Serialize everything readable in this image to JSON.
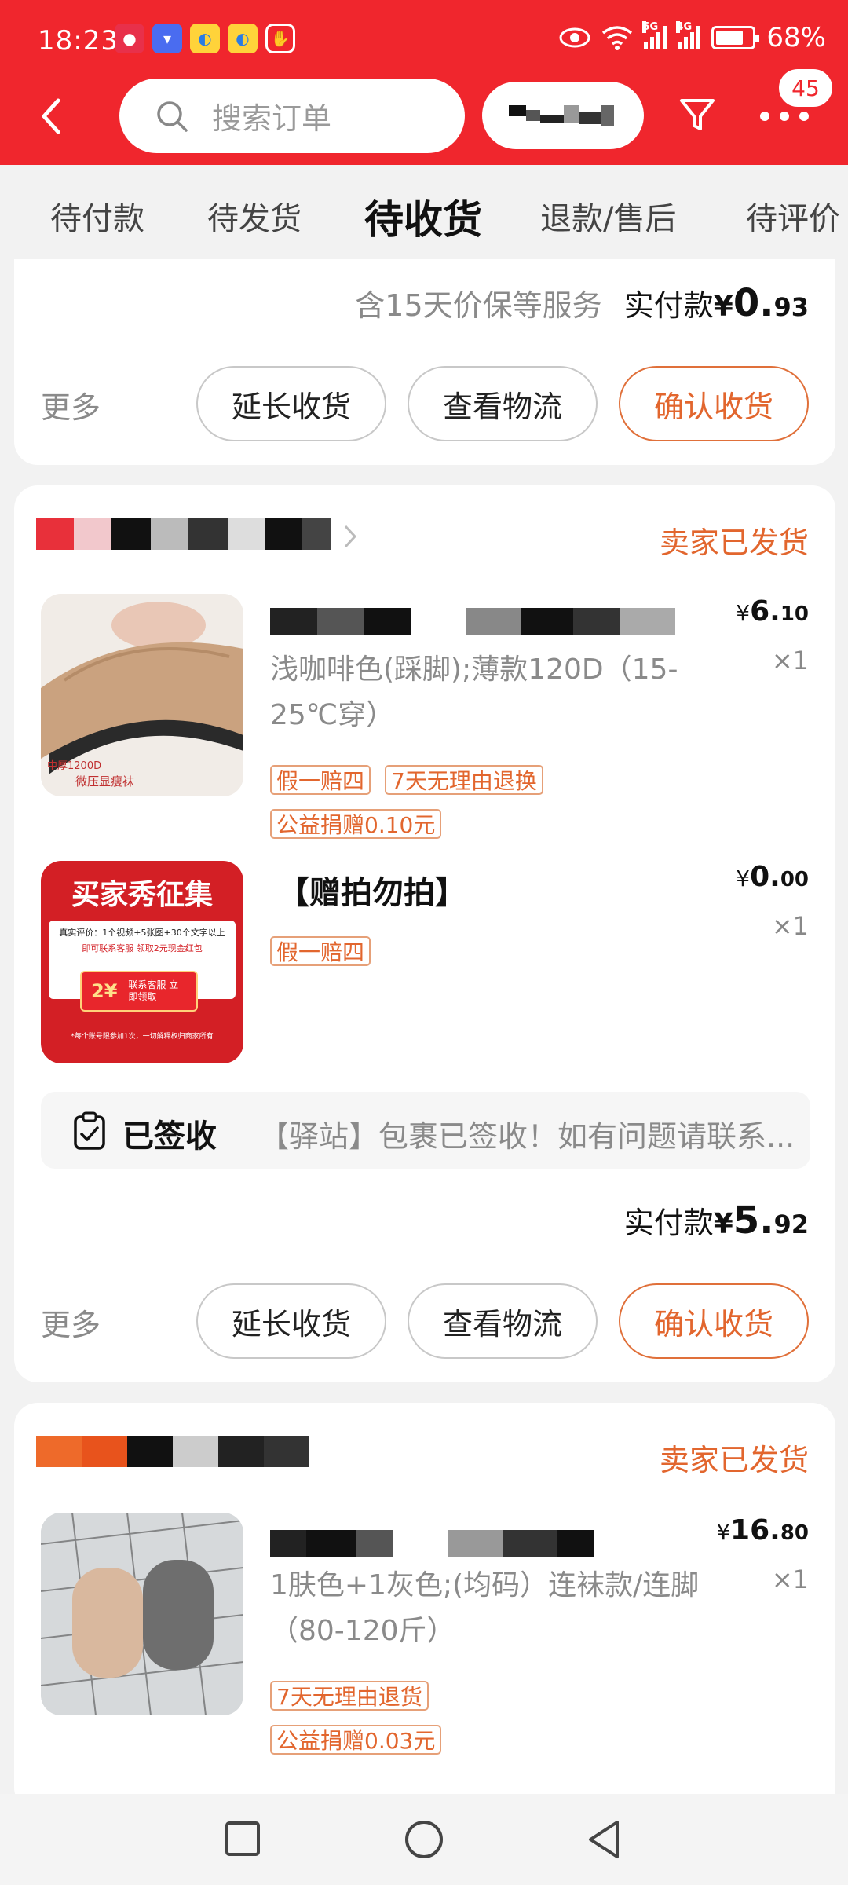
{
  "status_bar": {
    "time": "18:23",
    "battery": "68%",
    "net1": "5G",
    "net2": "4G"
  },
  "header": {
    "search_placeholder": "搜索订单",
    "badge_count": "45"
  },
  "tabs": [
    {
      "label": "待付款"
    },
    {
      "label": "待发货"
    },
    {
      "label": "待收货",
      "active": true
    },
    {
      "label": "退款/售后"
    },
    {
      "label": "待评价"
    }
  ],
  "orders": [
    {
      "service_note": "含15天价保等服务",
      "paid_label": "实付款",
      "paid_symbol": "¥",
      "paid_int": "0.",
      "paid_dec": "93",
      "more": "更多",
      "btn_extend": "延长收货",
      "btn_logistics": "查看物流",
      "btn_confirm": "确认收货"
    },
    {
      "status": "卖家已发货",
      "items": [
        {
          "spec": "浅咖啡色(踩脚);薄款120D（15-25℃穿）",
          "price_symbol": "¥",
          "price_int": "6.",
          "price_dec": "10",
          "qty": "×1",
          "tags": [
            "假一赔四",
            "7天无理由退换",
            "公益捐赠0.10元"
          ],
          "thumb_label": "中厚1200D",
          "thumb_label2": "微压显瘦袜"
        },
        {
          "title": "【赠拍勿拍】",
          "price_symbol": "¥",
          "price_int": "0.",
          "price_dec": "00",
          "qty": "×1",
          "tags": [
            "假一赔四"
          ],
          "thumb_title": "买家秀征集",
          "thumb_line1": "真实评价：1个视频+5张图+30个文字以上",
          "thumb_line2": "即可联系客服 领取2元现金红包",
          "thumb_btn_amount": "2¥",
          "thumb_btn_text": "联系客服 立即领取",
          "thumb_footer": "*每个账号限参加1次，一切解释权归商家所有"
        }
      ],
      "logistics_status": "已签收",
      "logistics_msg": "【驿站】包裹已签收！如有问题请联系...",
      "paid_label": "实付款",
      "paid_symbol": "¥",
      "paid_int": "5.",
      "paid_dec": "92",
      "more": "更多",
      "btn_extend": "延长收货",
      "btn_logistics": "查看物流",
      "btn_confirm": "确认收货"
    },
    {
      "status": "卖家已发货",
      "items": [
        {
          "spec": "1肤色+1灰色;(均码）连袜款/连脚（80-120斤）",
          "price_symbol": "¥",
          "price_int": "16.",
          "price_dec": "80",
          "qty": "×1",
          "tags": [
            "7天无理由退货",
            "公益捐赠0.03元"
          ]
        }
      ]
    }
  ],
  "colors": {
    "header_red": "#f0262d",
    "accent_orange": "#e2662e",
    "bg": "#f2f2f2"
  }
}
